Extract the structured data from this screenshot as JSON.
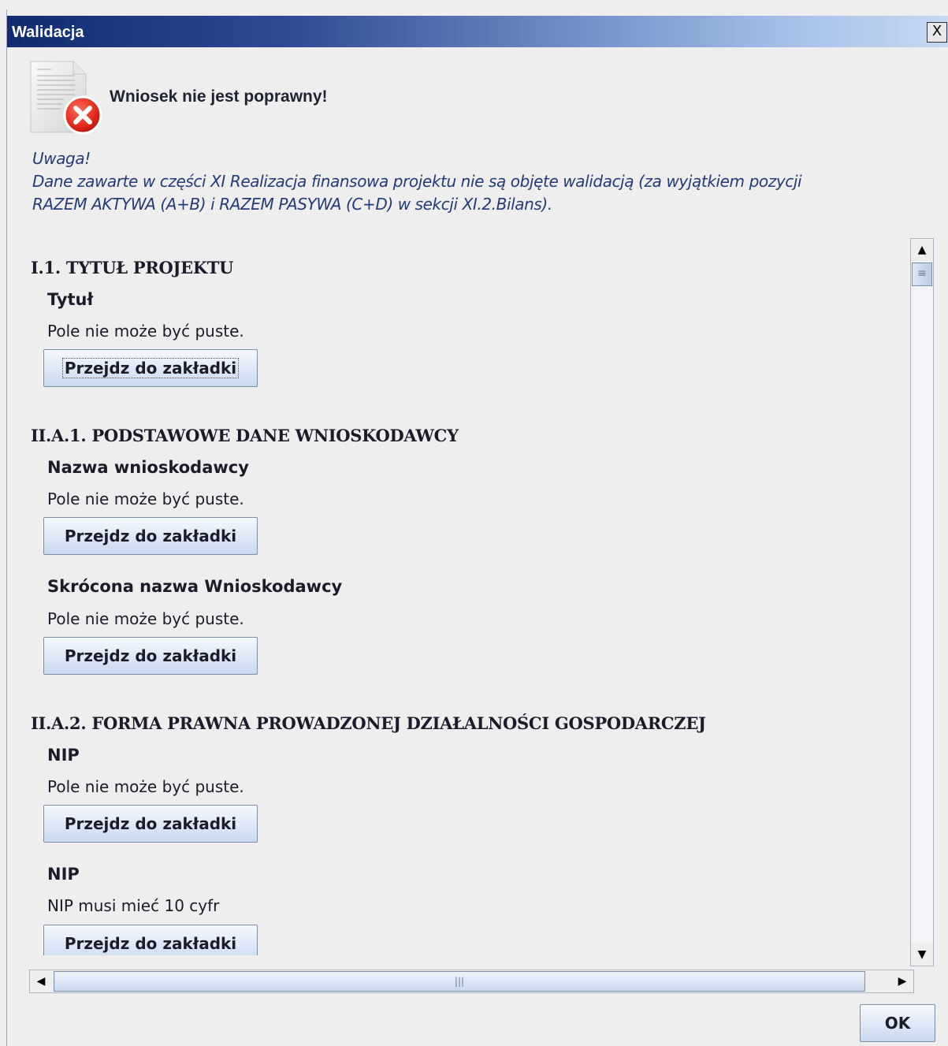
{
  "window": {
    "title": "Walidacja",
    "close_label": "X"
  },
  "header": {
    "title": "Wniosek nie jest poprawny!",
    "icon": "document-error-icon"
  },
  "warning": {
    "lines": [
      "Uwaga!",
      "Dane zawarte w części  XI Realizacja finansowa projektu nie są objęte walidacją (za wyjątkiem pozycji",
      "RAZEM AKTYWA (A+B) i RAZEM PASYWA (C+D) w sekcji  XI.2.Bilans)."
    ]
  },
  "sections": [
    {
      "title": "I.1. TYTUŁ PROJEKTU",
      "fields": [
        {
          "name": "Tytuł",
          "message": "Pole nie może być puste.",
          "button": "Przejdz do zakładki"
        }
      ]
    },
    {
      "title": "II.A.1. PODSTAWOWE DANE WNIOSKODAWCY",
      "fields": [
        {
          "name": "Nazwa wnioskodawcy",
          "message": "Pole nie może być puste.",
          "button": "Przejdz do zakładki"
        },
        {
          "name": "Skrócona nazwa Wnioskodawcy",
          "message": "Pole nie może być puste.",
          "button": "Przejdz do zakładki"
        }
      ]
    },
    {
      "title": "II.A.2. FORMA PRAWNA PROWADZONEJ DZIAŁALNOŚCI GOSPODARCZEJ",
      "fields": [
        {
          "name": "NIP",
          "message": "Pole nie może być puste.",
          "button": "Przejdz do zakładki"
        },
        {
          "name": "NIP",
          "message": "NIP musi mieć 10 cyfr",
          "button": "Przejdz do zakładki"
        }
      ]
    }
  ],
  "ok_button": "OK"
}
